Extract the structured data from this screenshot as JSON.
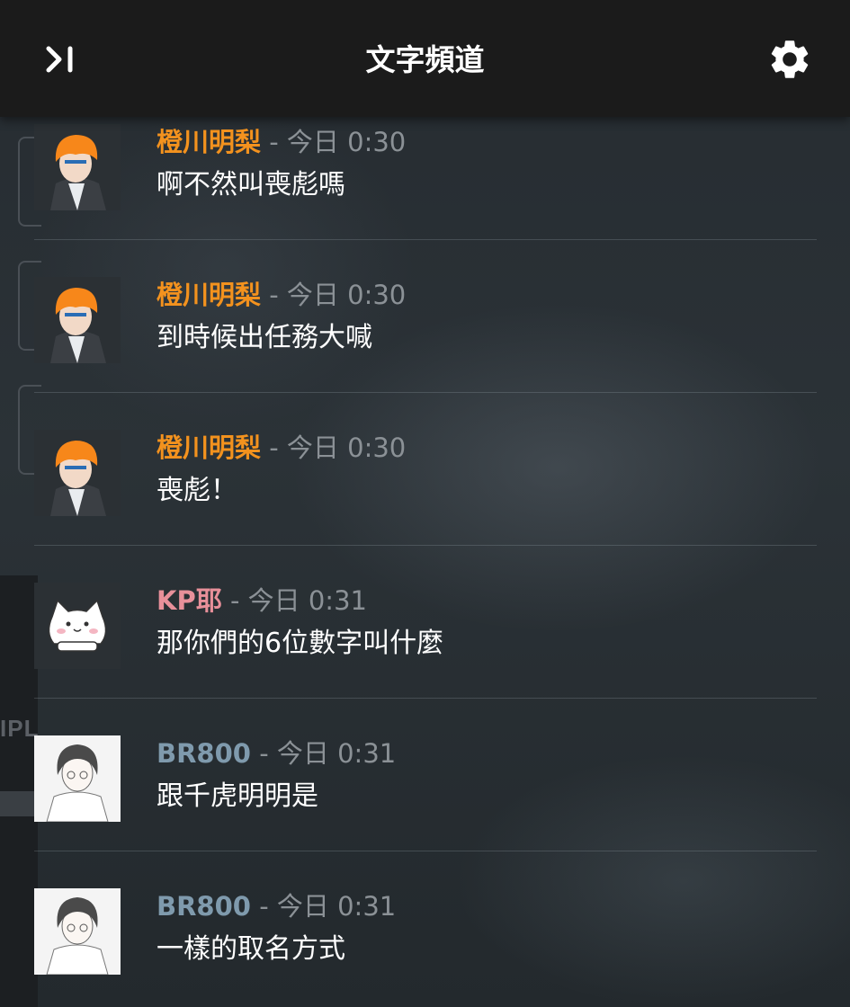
{
  "header": {
    "title": "文字頻道",
    "collapse_icon": "collapse-panel-icon",
    "settings_icon": "gear-icon"
  },
  "background": {
    "side_text": "IPL"
  },
  "colors": {
    "orange_user": "#f3921e",
    "pink_user": "#e8909a",
    "blue_user": "#7f9aad",
    "timestamp": "#8b9196"
  },
  "messages": [
    {
      "author": "橙川明梨",
      "separator": "-",
      "time": "今日 0:30",
      "text": "啊不然叫喪彪嗎"
    },
    {
      "author": "橙川明梨",
      "separator": "-",
      "time": "今日 0:30",
      "text": "到時候出任務大喊"
    },
    {
      "author": "橙川明梨",
      "separator": "-",
      "time": "今日 0:30",
      "text": "喪彪！"
    },
    {
      "author": "KP耶",
      "separator": "-",
      "time": "今日 0:31",
      "text": "那你們的6位數字叫什麼"
    },
    {
      "author": "BR800",
      "separator": "-",
      "time": "今日 0:31",
      "text": "跟千虎明明是"
    },
    {
      "author": "BR800",
      "separator": "-",
      "time": "今日 0:31",
      "text": "一樣的取名方式"
    }
  ]
}
